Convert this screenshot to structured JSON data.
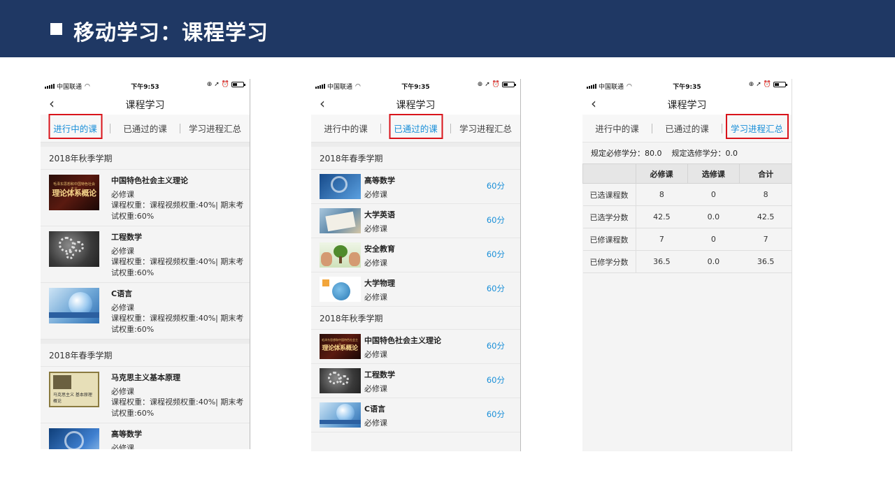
{
  "slide": {
    "title": "移动学习：课程学习"
  },
  "phones": [
    {
      "carrier": "中国联通",
      "time": "下午9:53",
      "nav_title": "课程学习",
      "tabs": [
        "进行中的课",
        "已通过的课",
        "学习进程汇总"
      ],
      "active_tab": 0,
      "semesters": [
        {
          "name": "2018年秋季学期",
          "courses": [
            {
              "name": "中国特色社会主义理论",
              "type": "必修课",
              "desc": "课程权重：课程视频权重:40%| 期末考试权重:60%"
            },
            {
              "name": "工程数学",
              "type": "必修课",
              "desc": "课程权重：课程视频权重:40%| 期末考试权重:60%"
            },
            {
              "name": "C语言",
              "type": "必修课",
              "desc": "课程权重：课程视频权重:40%| 期末考试权重:60%"
            }
          ]
        },
        {
          "name": "2018年春季学期",
          "courses": [
            {
              "name": "马克思主义基本原理",
              "type": "必修课",
              "desc": "课程权重：课程视频权重:40%| 期末考试权重:60%"
            },
            {
              "name": "高等数学",
              "type": "必修课",
              "desc": ""
            }
          ]
        }
      ],
      "thumb_text": {
        "dark_small": "毛泽东思想和中国特色社会主义",
        "dark_big": "理论体系概论",
        "marx": "马克思主义 基本原理概论"
      }
    },
    {
      "carrier": "中国联通",
      "time": "下午9:35",
      "nav_title": "课程学习",
      "tabs": [
        "进行中的课",
        "已通过的课",
        "学习进程汇总"
      ],
      "active_tab": 1,
      "semesters": [
        {
          "name": "2018年春季学期",
          "courses": [
            {
              "name": "高等数学",
              "type": "必修课",
              "score": "60分"
            },
            {
              "name": "大学英语",
              "type": "必修课",
              "score": "60分"
            },
            {
              "name": "安全教育",
              "type": "必修课",
              "score": "60分"
            },
            {
              "name": "大学物理",
              "type": "必修课",
              "score": "60分"
            }
          ]
        },
        {
          "name": "2018年秋季学期",
          "courses": [
            {
              "name": "中国特色社会主义理论",
              "type": "必修课",
              "score": "60分"
            },
            {
              "name": "工程数学",
              "type": "必修课",
              "score": "60分"
            },
            {
              "name": "C语言",
              "type": "必修课",
              "score": "60分"
            }
          ]
        }
      ],
      "thumb_text": {
        "dark_small": "毛泽东思想和中国特色社会主义",
        "dark_big": "理论体系概论"
      }
    },
    {
      "carrier": "中国联通",
      "time": "下午9:35",
      "nav_title": "课程学习",
      "tabs": [
        "进行中的课",
        "已通过的课",
        "学习进程汇总"
      ],
      "active_tab": 2,
      "credits": {
        "required": "规定必修学分：80.0",
        "elective": "规定选修学分：0.0"
      },
      "table": {
        "headers": [
          "",
          "必修课",
          "选修课",
          "合计"
        ],
        "rows": [
          [
            "已选课程数",
            "8",
            "0",
            "8"
          ],
          [
            "已选学分数",
            "42.5",
            "0.0",
            "42.5"
          ],
          [
            "已修课程数",
            "7",
            "0",
            "7"
          ],
          [
            "已修学分数",
            "36.5",
            "0.0",
            "36.5"
          ]
        ]
      }
    }
  ],
  "colors": {
    "header_bg": "#1f3864",
    "accent": "#1a8fd8",
    "highlight": "#d9141b"
  }
}
